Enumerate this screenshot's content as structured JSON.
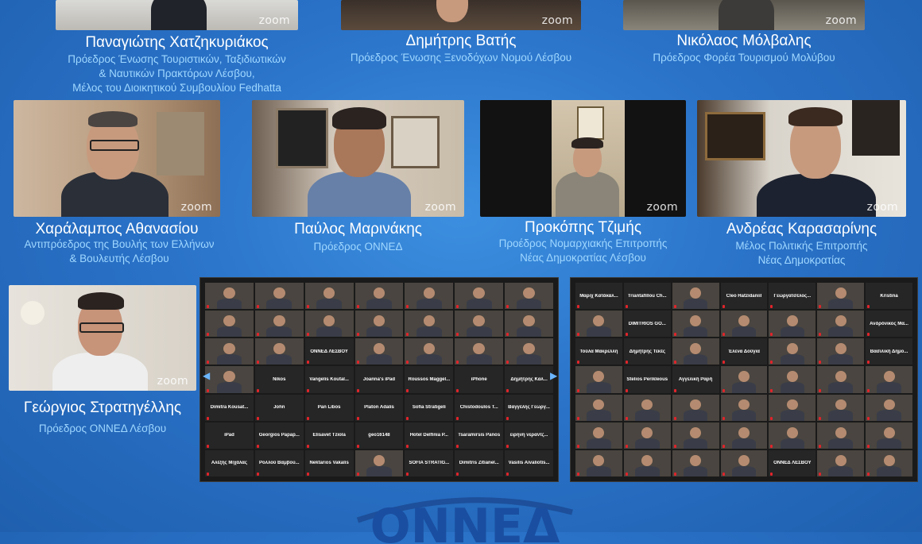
{
  "zoom_watermark": "zoom",
  "accent_colors": {
    "name_text": "#ffffff",
    "role_text": "#9fd7ff",
    "background": "#2a73c9"
  },
  "top_row": [
    {
      "name": "Παναγιώτης Χατζηκυριάκος",
      "role_lines": [
        "Πρόεδρος Ένωσης Τουριστικών, Ταξιδιωτικών",
        "& Ναυτικών Πρακτόρων Λέσβου,",
        "Μέλος του Διοικητικού Συμβουλίου Fedhatta"
      ]
    },
    {
      "name": "Δημήτρης Βατής",
      "role_lines": [
        "Πρόεδρος Ένωσης Ξενοδόχων Νομού Λέσβου"
      ]
    },
    {
      "name": "Νικόλαος Μόλβαλης",
      "role_lines": [
        "Πρόεδρος Φορέα Τουρισμού Μολύβου"
      ]
    }
  ],
  "middle_row": [
    {
      "name": "Χαράλαμπος Αθανασίου",
      "role_lines": [
        "Αντιπρόεδρος της Βουλής των Ελλήνων",
        "& Βουλευτής Λέσβου"
      ]
    },
    {
      "name": "Παύλος Μαρινάκης",
      "role_lines": [
        "Πρόεδρος ΟΝΝΕΔ"
      ]
    },
    {
      "name": "Προκόπης Τζιμής",
      "role_lines": [
        "Προέδρος Νομαρχιακής Επιτροπής",
        "Νέας Δημοκρατίας Λέσβου"
      ]
    },
    {
      "name": "Ανδρέας Καρασαρίνης",
      "role_lines": [
        "Μέλος Πολιτικής Επιτροπής",
        "Νέας Δημοκρατίας"
      ]
    }
  ],
  "bottom_left": {
    "name": "Γεώργιος Στρατηγέλλης",
    "role_lines": [
      "Πρόεδρος ΟΝΝΕΔ Λέσβου"
    ]
  },
  "gallery_left": {
    "rows": [
      [
        "v",
        "v",
        "v",
        "v",
        "v",
        "v",
        "v"
      ],
      [
        "v",
        "v",
        "v",
        "v",
        "v",
        "v",
        "v"
      ],
      [
        "v",
        "v",
        "ΟΝΝΕΔ ΛΕΣΒΟΥ",
        "v",
        "v",
        "v",
        "v"
      ],
      [
        "v",
        "Nikos",
        "Vangelis Koutal...",
        "Joanna's iPad",
        "Roussos Maggel...",
        "iPhone",
        "Δημήτρης Καλ..."
      ],
      [
        "Dimitra Kousat...",
        "John",
        "Pan Libos",
        "Platon Adalis",
        "Sofia Stratigeli",
        "Chistodoulos T...",
        "Βαγγέλης Γεωργ..."
      ],
      [
        "iPad",
        "Georgios Papap...",
        "Elisavet Tziola",
        "geo16148",
        "Hotel Delfinia P...",
        "Tsaramirsis Panos",
        "ειρηνη νεραντζ..."
      ],
      [
        "Αλέξης Μιχάλας",
        "Ρολλού Βαμβου...",
        "Nektarios Vakalis",
        "v",
        "SOFIA STRATIG...",
        "Dimitris Zitianel...",
        "Vasilis Aivaliotis..."
      ]
    ]
  },
  "gallery_right": {
    "rows": [
      [
        "Μαριχ Κατάκαλ...",
        "Triantafillou Ch...",
        "v",
        "Cleo Hatzidaniil",
        "Γεωργατσέλος...",
        "v",
        "Kristina"
      ],
      [
        "v",
        "DIMITRIOS GO...",
        "v",
        "v",
        "v",
        "v",
        "Ανδρόνικος Μα..."
      ],
      [
        "Τούλα Μακρελλη",
        "Δημήτρης Τεκές",
        "v",
        "Έλενα Δούγια",
        "v",
        "v",
        "Βασιλική Δημο..."
      ],
      [
        "v",
        "Stelios Perikleous",
        "Αγγελική Ραρή",
        "v",
        "v",
        "v",
        "v"
      ],
      [
        "v",
        "v",
        "v",
        "v",
        "v",
        "v",
        "v"
      ],
      [
        "v",
        "v",
        "v",
        "v",
        "v",
        "v",
        "v"
      ],
      [
        "v",
        "v",
        "v",
        "v",
        "ΟΝΝΕΔ ΛΕΣΒΟΥ",
        "v",
        "v"
      ]
    ]
  },
  "logo_text": "ONNEΔ"
}
